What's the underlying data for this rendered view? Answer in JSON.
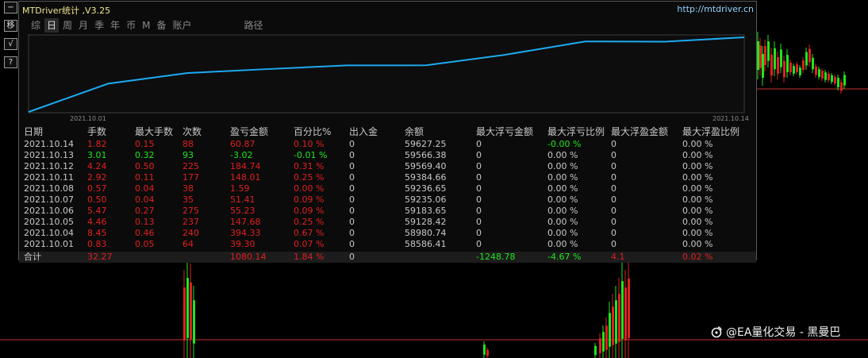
{
  "side_buttons": [
    "−",
    "移",
    "√",
    "?"
  ],
  "panel": {
    "title": "MTDriver统计 ,V3.25",
    "url": "http://mtdriver.cn"
  },
  "tabs": [
    "综",
    "日",
    "周",
    "月",
    "季",
    "年",
    "币",
    "M",
    "备",
    "账户",
    "路径"
  ],
  "active_tab": "日",
  "equity_chart": {
    "x_start_label": "2021.10.01",
    "x_end_label": "2021.10.14",
    "line_color": "#1eaaf0",
    "balances": [
      58586.41,
      58980.74,
      59128.42,
      59183.65,
      59235.06,
      59236.65,
      59384.66,
      59569.4,
      59566.38,
      59627.25
    ]
  },
  "table": {
    "headers": [
      "日期",
      "手数",
      "最大手数",
      "次数",
      "盈亏金额",
      "百分比%",
      "出入金",
      "余额",
      "最大浮亏金额",
      "最大浮亏比例",
      "最大浮盈金额",
      "最大浮盈比例"
    ],
    "rows": [
      {
        "tone": "red",
        "cells": [
          "2021.10.14",
          "1.82",
          "0.15",
          "88",
          "60.87",
          "0.10 %",
          "0",
          "59627.25",
          "0",
          "-0.00 %",
          "0",
          "0.00 %"
        ]
      },
      {
        "tone": "green",
        "cells": [
          "2021.10.13",
          "3.01",
          "0.32",
          "93",
          "-3.02",
          "-0.01 %",
          "0",
          "59566.38",
          "0",
          "0.00 %",
          "0",
          "0.00 %"
        ]
      },
      {
        "tone": "red",
        "cells": [
          "2021.10.12",
          "4.24",
          "0.50",
          "225",
          "184.74",
          "0.31 %",
          "0",
          "59569.40",
          "0",
          "0.00 %",
          "0",
          "0.00 %"
        ]
      },
      {
        "tone": "red",
        "cells": [
          "2021.10.11",
          "2.92",
          "0.11",
          "177",
          "148.01",
          "0.25 %",
          "0",
          "59384.66",
          "0",
          "0.00 %",
          "0",
          "0.00 %"
        ]
      },
      {
        "tone": "red",
        "cells": [
          "2021.10.08",
          "0.57",
          "0.04",
          "38",
          "1.59",
          "0.00 %",
          "0",
          "59236.65",
          "0",
          "0.00 %",
          "0",
          "0.00 %"
        ]
      },
      {
        "tone": "red",
        "cells": [
          "2021.10.07",
          "0.50",
          "0.04",
          "35",
          "51.41",
          "0.09 %",
          "0",
          "59235.06",
          "0",
          "0.00 %",
          "0",
          "0.00 %"
        ]
      },
      {
        "tone": "red",
        "cells": [
          "2021.10.06",
          "5.47",
          "0.27",
          "275",
          "55.23",
          "0.09 %",
          "0",
          "59183.65",
          "0",
          "0.00 %",
          "0",
          "0.00 %"
        ]
      },
      {
        "tone": "red",
        "cells": [
          "2021.10.05",
          "4.46",
          "0.13",
          "237",
          "147.68",
          "0.25 %",
          "0",
          "59128.42",
          "0",
          "0.00 %",
          "0",
          "0.00 %"
        ]
      },
      {
        "tone": "red",
        "cells": [
          "2021.10.04",
          "8.45",
          "0.46",
          "240",
          "394.33",
          "0.67 %",
          "0",
          "58980.74",
          "0",
          "0.00 %",
          "0",
          "0.00 %"
        ]
      },
      {
        "tone": "red",
        "cells": [
          "2021.10.01",
          "0.83",
          "0.05",
          "64",
          "39.30",
          "0.07 %",
          "0",
          "58586.41",
          "0",
          "0.00 %",
          "0",
          "0.00 %"
        ]
      }
    ],
    "total": {
      "label": "合计",
      "lots": "32.27",
      "profit": "1080.14",
      "percent": "1.84 %",
      "deposit": "0",
      "max_float_loss": "-1248.78",
      "max_float_loss_pct": "-4.67 %",
      "max_float_profit": "4.1",
      "max_float_profit_pct": "0.02 %"
    }
  },
  "colors": {
    "red": "#e02020",
    "green": "#1ee61e",
    "white": "#c8c8c8",
    "hline": "#c83232"
  },
  "watermark": {
    "text": "@EA量化交易 - 黑曼巴",
    "icon": "weibo-like-icon"
  }
}
